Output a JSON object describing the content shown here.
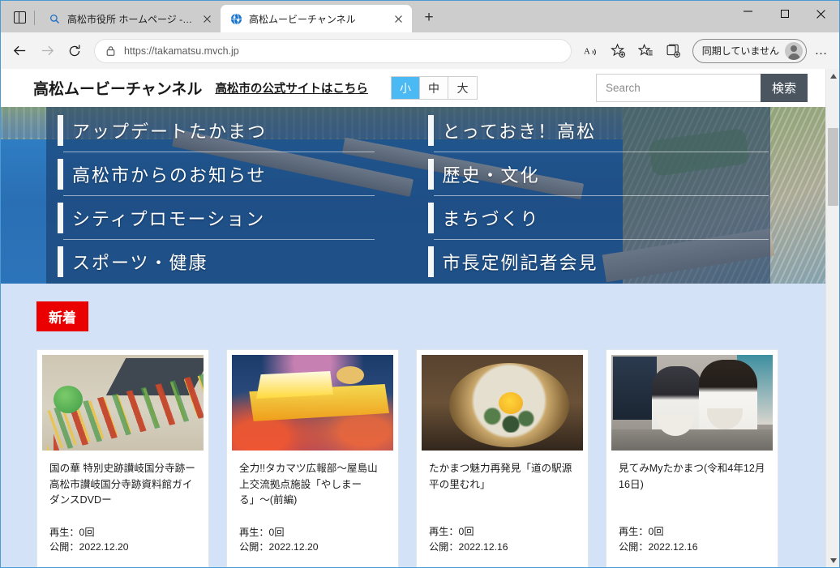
{
  "browser": {
    "tab_list_label": "tab actions",
    "tabs": [
      {
        "title": "高松市役所 ホームページ - 検索",
        "icon": "search-icon",
        "active": false
      },
      {
        "title": "高松ムービーチャンネル",
        "icon": "globe-favicon",
        "active": true
      }
    ],
    "new_tab_label": "+",
    "window_controls": {
      "minimize": "−",
      "maximize": "□",
      "close": "✕"
    },
    "nav": {
      "back": "←",
      "forward": "→",
      "reload": "↻",
      "url": "https://takamatsu.mvch.jp",
      "read_aloud": "A",
      "add_favorite": "add-favorite-icon",
      "favorites": "favorites-icon",
      "collections": "collections-icon",
      "profile_label": "同期していません",
      "settings_more": "…"
    }
  },
  "site": {
    "title": "高松ムービーチャンネル",
    "official_link": "高松市の公式サイトはこちら",
    "font_sizes": [
      {
        "label": "小",
        "active": true
      },
      {
        "label": "中",
        "active": false
      },
      {
        "label": "大",
        "active": false
      }
    ],
    "search": {
      "value": "",
      "placeholder": "Search",
      "button": "検索"
    },
    "accent_blue": "#4ab9f4",
    "badge_red": "#ea0000",
    "panel_blue": "#d3e2f7"
  },
  "hero": {
    "menu": [
      {
        "label": "アップデートたかまつ",
        "column": 1
      },
      {
        "label": "とっておき！高松",
        "column": 2
      },
      {
        "label": "高松市からのお知らせ",
        "column": 1
      },
      {
        "label": "歴史・文化",
        "column": 2
      },
      {
        "label": "シティプロモーション",
        "column": 1
      },
      {
        "label": "まちづくり",
        "column": 2
      },
      {
        "label": "スポーツ・健康",
        "column": 1
      },
      {
        "label": "市長定例記者会見",
        "column": 2
      }
    ]
  },
  "news": {
    "badge": "新着",
    "cards": [
      {
        "title": "国の華 特別史跡讃岐国分寺跡ー高松市讃岐国分寺跡資料館ガイダンスDVDー",
        "plays": "再生：0回",
        "published": "公開：2022.12.20",
        "thumb": "kokubunji-illustration"
      },
      {
        "title": "全力!!タカマツ広報部〜屋島山上交流拠点施設「やしまーる」〜(前編)",
        "plays": "再生：0回",
        "published": "公開：2022.12.20",
        "thumb": "zenryoku-takamatsu-logo"
      },
      {
        "title": "たかまつ魅力再発見「道の駅源平の里むれ」",
        "plays": "再生：0回",
        "published": "公開：2022.12.16",
        "thumb": "seafood-donburi"
      },
      {
        "title": "見てみMyたかまつ(令和4年12月16日)",
        "plays": "再生：0回",
        "published": "公開：2022.12.16",
        "thumb": "school-lunch"
      }
    ]
  }
}
